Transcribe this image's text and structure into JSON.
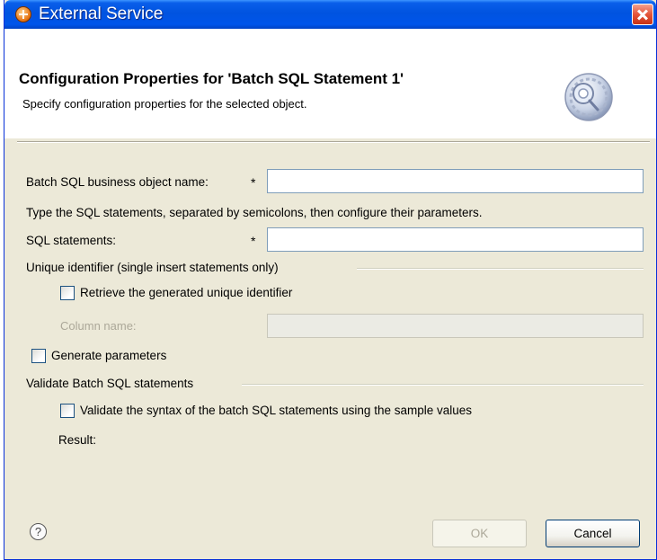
{
  "window": {
    "title": "External Service"
  },
  "header": {
    "heading": "Configuration Properties for 'Batch SQL Statement 1'",
    "description": "Specify configuration properties for the selected object."
  },
  "form": {
    "bo_name_label": "Batch SQL business object name:",
    "bo_name_required": "*",
    "bo_name_value": "",
    "instructions": "Type the SQL statements, separated by semicolons, then configure their parameters.",
    "sql_label": "SQL statements:",
    "sql_required": "*",
    "sql_value": "",
    "unique_group_label": "Unique identifier (single insert statements only)",
    "retrieve_label": "Retrieve the generated unique identifier",
    "retrieve_checked": false,
    "column_name_label": "Column name:",
    "column_name_value": "",
    "generate_params_label": "Generate parameters",
    "generate_params_checked": false,
    "validate_group_label": "Validate Batch SQL statements",
    "validate_label": "Validate the syntax of the batch SQL statements using the sample values",
    "validate_checked": false,
    "result_label": "Result:"
  },
  "footer": {
    "help_symbol": "?",
    "ok_label": "OK",
    "cancel_label": "Cancel"
  },
  "colors": {
    "titlebar": "#0053e0",
    "dialog_bg": "#ece9d8",
    "input_border": "#7f9db9",
    "disabled_text": "#aca899"
  },
  "icons": [
    "app-icon",
    "close-icon",
    "wizard-gear-icon",
    "help-icon"
  ]
}
